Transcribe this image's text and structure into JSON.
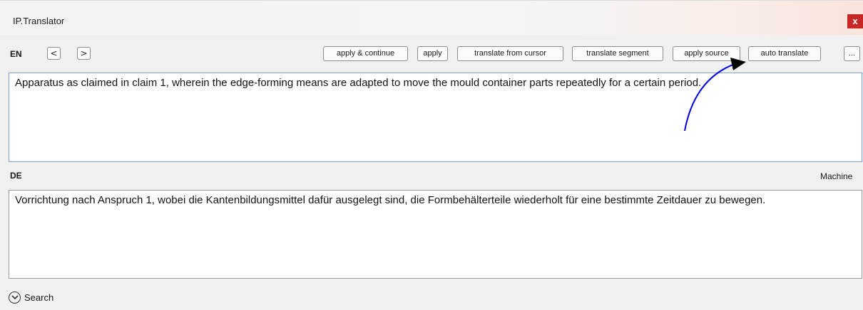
{
  "window": {
    "title": "IP.Translator",
    "close_label": "x"
  },
  "source": {
    "lang": "EN",
    "prev_label": "<",
    "next_label": ">",
    "text": "Apparatus as claimed in claim 1, wherein the edge-forming means are adapted to move the mould container parts repeatedly for a certain period."
  },
  "toolbar": {
    "apply_continue": "apply & continue",
    "apply": "apply",
    "translate_from_cursor": "translate from cursor",
    "translate_segment": "translate segment",
    "apply_source": "apply source",
    "auto_translate": "auto translate",
    "more": "..."
  },
  "target": {
    "lang": "DE",
    "origin": "Machine",
    "text": "Vorrichtung nach Anspruch 1, wobei die Kantenbildungsmittel dafür ausgelegt sind, die Formbehälterteile wiederholt für eine bestimmte Zeitdauer zu bewegen."
  },
  "search": {
    "label": "Search",
    "icon": "chevron-down-circle-icon"
  },
  "colors": {
    "close_bg": "#c62828",
    "focus_border": "#7ba0d8",
    "annotation_arrow": "#0000dd"
  }
}
